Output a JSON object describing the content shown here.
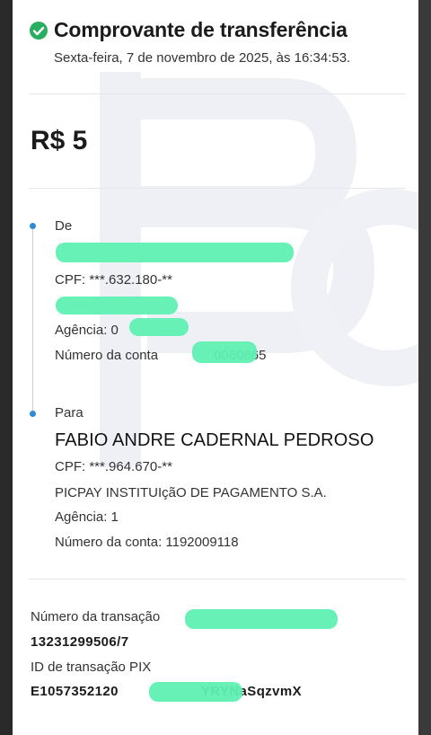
{
  "header": {
    "title": "Comprovante de transferência",
    "datetime": "Sexta-feira, 7 de novembro de 2025, às 16:34:53."
  },
  "amount": "R$ 5",
  "from": {
    "label": "De",
    "cpf": "CPF: ***.632.180-**",
    "agencia": "Agência: 0",
    "conta_prefix": "Número da conta",
    "conta_suffix": "0060865"
  },
  "to": {
    "label": "Para",
    "name": "FABIO ANDRE CADERNAL PEDROSO",
    "cpf": "CPF: ***.964.670-**",
    "institution": "PICPAY INSTITUIçãO DE PAGAMENTO S.A.",
    "agencia": "Agência: 1",
    "conta": "Número da conta: 1192009118"
  },
  "transaction": {
    "number_label": "Número da transação",
    "number_value": "13231299506/7",
    "pix_label": "ID de transação PIX",
    "pix_prefix": "E1057352120",
    "pix_suffix": "YRYNaSqzvmX"
  },
  "colors": {
    "accent_green": "#27ae60",
    "timeline_dot": "#2e8bd6",
    "redaction": "#5ff0b2"
  }
}
